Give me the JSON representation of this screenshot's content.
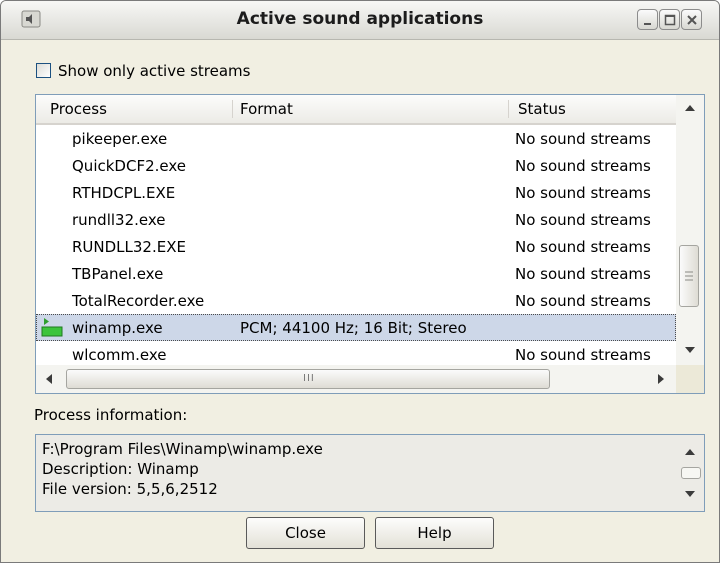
{
  "window": {
    "title": "Active sound applications"
  },
  "options": {
    "show_only_active_label": "Show only active streams",
    "show_only_active_checked": false
  },
  "list": {
    "columns": [
      "Process",
      "Format",
      "Status"
    ],
    "rows": [
      {
        "process": "pikeeper.exe",
        "format": "",
        "status": "No sound streams",
        "active": false
      },
      {
        "process": "QuickDCF2.exe",
        "format": "",
        "status": "No sound streams",
        "active": false
      },
      {
        "process": "RTHDCPL.EXE",
        "format": "",
        "status": "No sound streams",
        "active": false
      },
      {
        "process": "rundll32.exe",
        "format": "",
        "status": "No sound streams",
        "active": false
      },
      {
        "process": "RUNDLL32.EXE",
        "format": "",
        "status": "No sound streams",
        "active": false
      },
      {
        "process": "TBPanel.exe",
        "format": "",
        "status": "No sound streams",
        "active": false
      },
      {
        "process": "TotalRecorder.exe",
        "format": "",
        "status": "No sound streams",
        "active": false
      },
      {
        "process": "winamp.exe",
        "format": "PCM; 44100 Hz; 16 Bit; Stereo",
        "status": "",
        "active": true
      },
      {
        "process": "wlcomm.exe",
        "format": "",
        "status": "No sound streams",
        "active": false
      }
    ],
    "selected_index": 7,
    "hscroll_glyph": "III"
  },
  "info": {
    "label": "Process information:",
    "lines": [
      "F:\\Program Files\\Winamp\\winamp.exe",
      "Description: Winamp",
      "File version: 5,5,6,2512"
    ]
  },
  "buttons": {
    "close_label": "Close",
    "help_label": "Help"
  },
  "colors": {
    "selection": "#cdd7e8",
    "active_stream_icon": "#3cc43c"
  }
}
